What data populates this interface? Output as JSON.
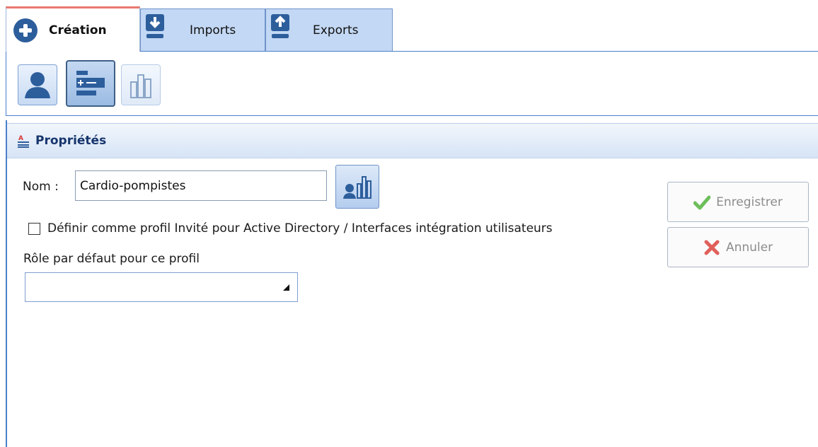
{
  "tabs": [
    {
      "label": "Création",
      "icon": "plus-circle-icon",
      "selected": true
    },
    {
      "label": "Imports",
      "icon": "import-tray-icon",
      "selected": false
    },
    {
      "label": "Exports",
      "icon": "export-tray-icon",
      "selected": false
    }
  ],
  "ribbon": {
    "buttons": [
      {
        "icon": "user-icon",
        "selected": false,
        "enabled": true
      },
      {
        "icon": "profile-list-icon",
        "selected": true,
        "enabled": true
      },
      {
        "icon": "building-chart-icon",
        "selected": false,
        "enabled": false
      }
    ]
  },
  "properties": {
    "title": "Propriétés",
    "title_icon": "properties-icon",
    "name_label": "Nom :",
    "name_value": "Cardio-pompistes",
    "users_button_icon": "users-chart-icon",
    "guest_checkbox_label": "Définir comme profil Invité pour Active Directory / Interfaces intégration utilisateurs",
    "guest_checkbox_checked": false,
    "role_label": "Rôle par défaut pour ce profil",
    "role_value": ""
  },
  "actions": {
    "save_label": "Enregistrer",
    "save_enabled": false,
    "cancel_label": "Annuler",
    "cancel_enabled": false
  },
  "colors": {
    "accent_blue": "#2d5e9c",
    "tab_bg": "#c3d8f4",
    "header_text": "#17366e",
    "selected_tab_top": "#e8786e",
    "check_green": "#6dbf5b",
    "cross_red": "#e0605a"
  }
}
